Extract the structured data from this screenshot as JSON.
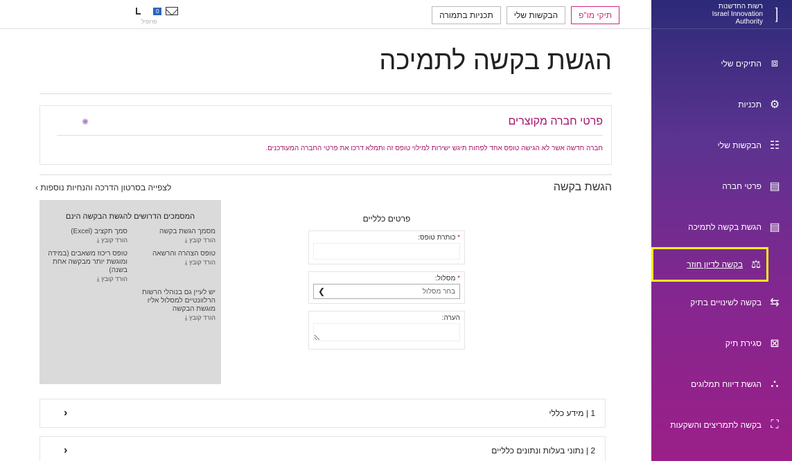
{
  "logo": {
    "mark": "⌈⌈  ⌊⌊",
    "line1": "רשות החדשנות",
    "line2": "Israel Innovation",
    "line3": "Authority"
  },
  "sidebar": {
    "items": [
      {
        "label": "התיקים שלי",
        "icon": "briefcase-icon",
        "glyph": "⧈"
      },
      {
        "label": "תכניות",
        "icon": "gear-icon",
        "glyph": "⚙"
      },
      {
        "label": "הבקשות שלי",
        "icon": "user-list-icon",
        "glyph": "☷"
      },
      {
        "label": "פרטי חברה",
        "icon": "document-icon",
        "glyph": "▤"
      },
      {
        "label": "הגשת בקשה לתמיכה",
        "icon": "document-icon",
        "glyph": "▤"
      },
      {
        "label": "בקשה לדיון חוזר",
        "icon": "gavel-icon",
        "glyph": "⚖"
      },
      {
        "label": "בקשה לשינויים בתיק",
        "icon": "arrows-icon",
        "glyph": "⇆"
      },
      {
        "label": "סגירת תיק",
        "icon": "close-folder-icon",
        "glyph": "⊠"
      },
      {
        "label": "הגשת דיווח תמלוגים",
        "icon": "hierarchy-icon",
        "glyph": "⛬"
      },
      {
        "label": "בקשה לתמריצים והשקעות",
        "icon": "frame-icon",
        "glyph": "⛶"
      }
    ]
  },
  "topbar": {
    "tab1": "תיקי מו\"פ",
    "tab2": "הבקשות שלי",
    "tab3": "תכניות בתמורה",
    "badge": "0",
    "user": "פרופיל"
  },
  "page": {
    "title": "הגשת בקשה לתמיכה"
  },
  "company": {
    "title": "פרטי חברה מקוצרים",
    "note": "חברה חדשה אשר לא הגישה טופס אחד לפחות תיגש ישירות למילוי טופס זה ותמלא דרכו את פרטי החברה המעודכנים."
  },
  "section": {
    "title": "הגשת בקשה",
    "video_link": "לצפייה בסרטון הדרכה והנחיות נוספות"
  },
  "form": {
    "heading": "פרטים כלליים",
    "form_title_label": "כותרת טופס:",
    "track_label": "מסלול:",
    "track_placeholder": "בחר מסלול",
    "note_label": "הערה:"
  },
  "docs": {
    "title": "המסמכים הדרושים להגשת הבקשה הינם",
    "download": "הורד קובץ",
    "items": [
      {
        "name": "מסמך הגשת בקשה"
      },
      {
        "name": "סמך תקציב (Excel)"
      },
      {
        "name": "טופס הצהרה והרשאה"
      },
      {
        "name": "טופס ריכוז משאבים (במידה ומוגשת יותר מבקשה אחת בשנה)"
      },
      {
        "name": "יש לעיין גם בנוהלי הרשות הרלוונטיים למסלול אליו מוגשת הבקשה"
      }
    ]
  },
  "accordion": [
    {
      "label": "1 | מידע כללי"
    },
    {
      "label": "2 | נתוני בעלות ונתונים כלליים"
    }
  ],
  "colors": {
    "accent": "#d2267c",
    "highlight": "#f5ef1c",
    "title_color": "#a3146a"
  }
}
